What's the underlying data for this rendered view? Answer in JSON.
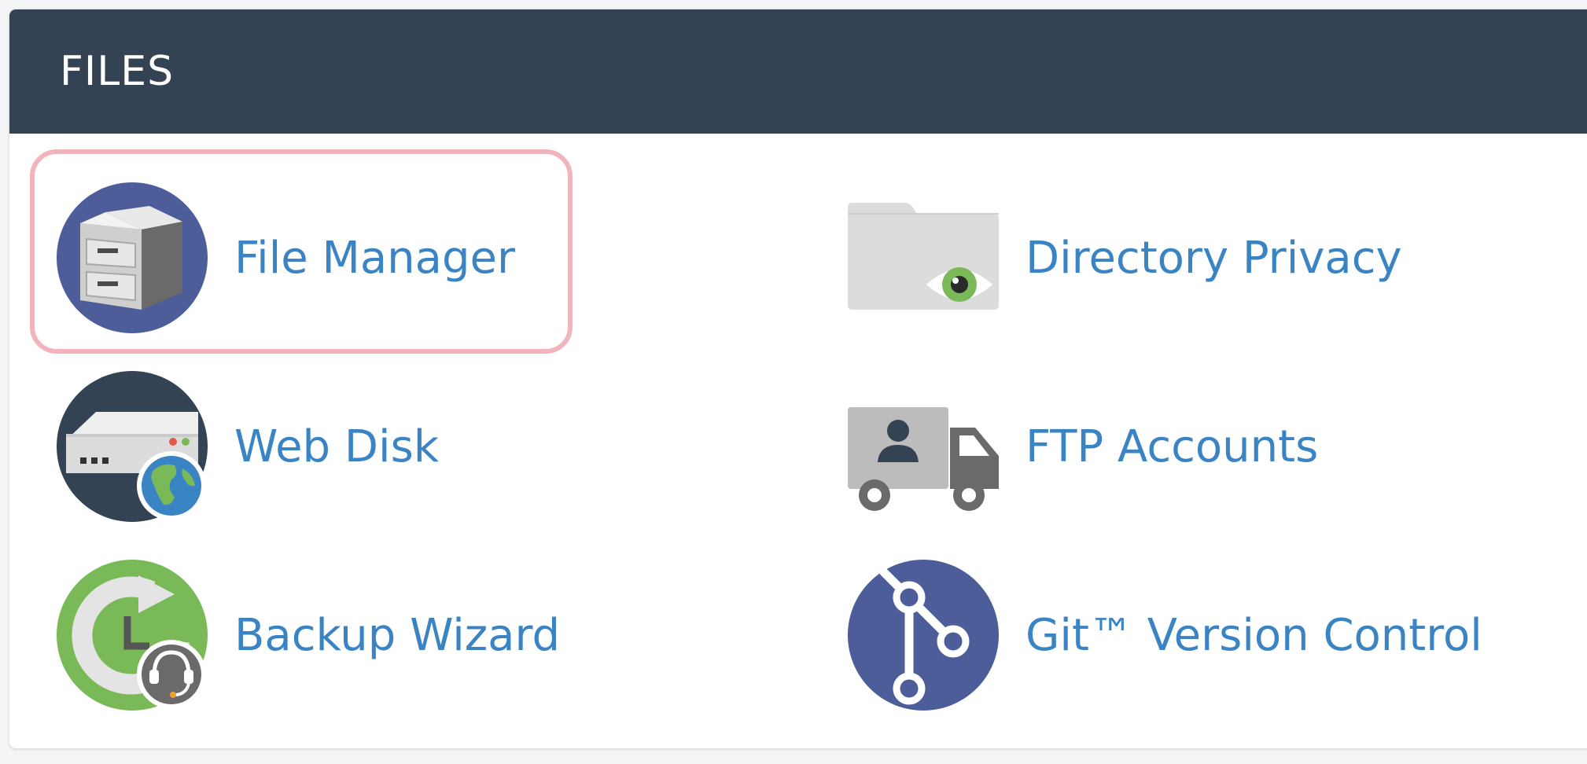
{
  "section": {
    "title": "FILES"
  },
  "items": [
    {
      "label": "File Manager",
      "icon": "file-cabinet-icon",
      "selected": true
    },
    {
      "label": "Directory Privacy",
      "icon": "folder-eye-icon"
    },
    {
      "label": "Web Disk",
      "icon": "server-globe-icon"
    },
    {
      "label": "FTP Accounts",
      "icon": "delivery-truck-icon"
    },
    {
      "label": "Backup Wizard",
      "icon": "backup-clock-icon"
    },
    {
      "label": "Git™ Version Control",
      "icon": "git-branch-icon"
    }
  ],
  "colors": {
    "header": "#344353",
    "link": "#3b84c4",
    "selection": "#f2b4bc",
    "icon_blue": "#4d5d99",
    "icon_navy": "#344353",
    "icon_green": "#7ab957"
  }
}
